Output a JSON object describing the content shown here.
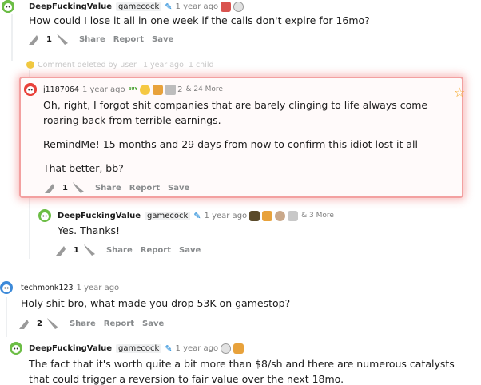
{
  "c1": {
    "author": "DeepFuckingValue",
    "flair": "gamecock",
    "time": "1 year ago",
    "body": "How could I lose it all in one week if the calls don't expire for 16mo?",
    "score": "1",
    "share": "Share",
    "report": "Report",
    "save": "Save"
  },
  "deleted": {
    "text": "Comment deleted by user",
    "time": "1 year ago",
    "children": "1 child"
  },
  "c2": {
    "author": "j1187064",
    "time": "1 year ago",
    "badge": "BUY",
    "award_count": "2",
    "more": "& 24 More",
    "p1": "Oh, right, I forgot shit companies that are barely clinging to life always come roaring back from terrible earnings.",
    "p2": "RemindMe! 15 months and 29 days from now to confirm this idiot lost it all",
    "p3": "That better, bb?",
    "score": "1",
    "share": "Share",
    "report": "Report",
    "save": "Save"
  },
  "c3": {
    "author": "DeepFuckingValue",
    "flair": "gamecock",
    "time": "1 year ago",
    "more": "& 3 More",
    "body": "Yes. Thanks!",
    "score": "1",
    "share": "Share",
    "report": "Report",
    "save": "Save"
  },
  "c4": {
    "author": "techmonk123",
    "time": "1 year ago",
    "body": "Holy shit bro, what made you drop 53K on gamestop?",
    "score": "2",
    "share": "Share",
    "report": "Report",
    "save": "Save"
  },
  "c5": {
    "author": "DeepFuckingValue",
    "flair": "gamecock",
    "time": "1 year ago",
    "body": "The fact that it's worth quite a bit more than $8/sh and there are numerous catalysts that could trigger a reversion to fair value over the next 18mo."
  },
  "colors": {
    "accent": "#0079d3",
    "highlight": "#f3a0a0",
    "deleted": "#c8c8c8"
  }
}
